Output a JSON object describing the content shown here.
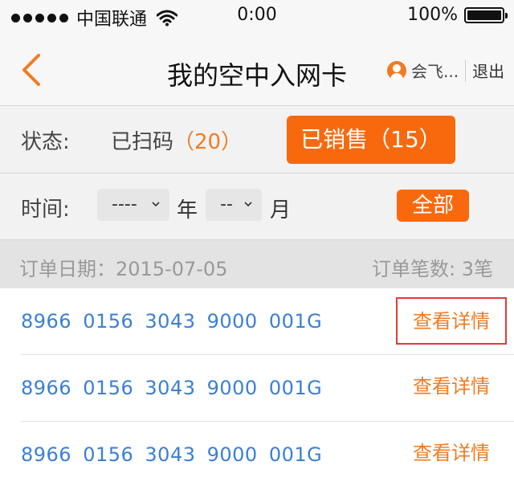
{
  "status_bar": {
    "carrier": "中国联通",
    "time": "0:00",
    "battery": "100%"
  },
  "nav": {
    "title": "我的空中入网卡",
    "username": "会飞...",
    "logout": "退出"
  },
  "filters": {
    "status_label": "状态:",
    "scanned_label": "已扫码",
    "scanned_count": "（20）",
    "sold_label": "已销售（15）",
    "time_label": "时间:",
    "year_value": "----",
    "year_unit": "年",
    "month_value": "--",
    "month_unit": "月",
    "all_button": "全部"
  },
  "order_header": {
    "date_text": "订单日期：2015-07-05",
    "count_text": "订单笔数: 3笔"
  },
  "orders": [
    {
      "card_number": "8966 0156 3043 9000 001G",
      "detail_label": "查看详情"
    },
    {
      "card_number": "8966 0156 3043 9000 001G",
      "detail_label": "查看详情"
    },
    {
      "card_number": "8966 0156 3043 9000 001G",
      "detail_label": "查看详情"
    }
  ]
}
